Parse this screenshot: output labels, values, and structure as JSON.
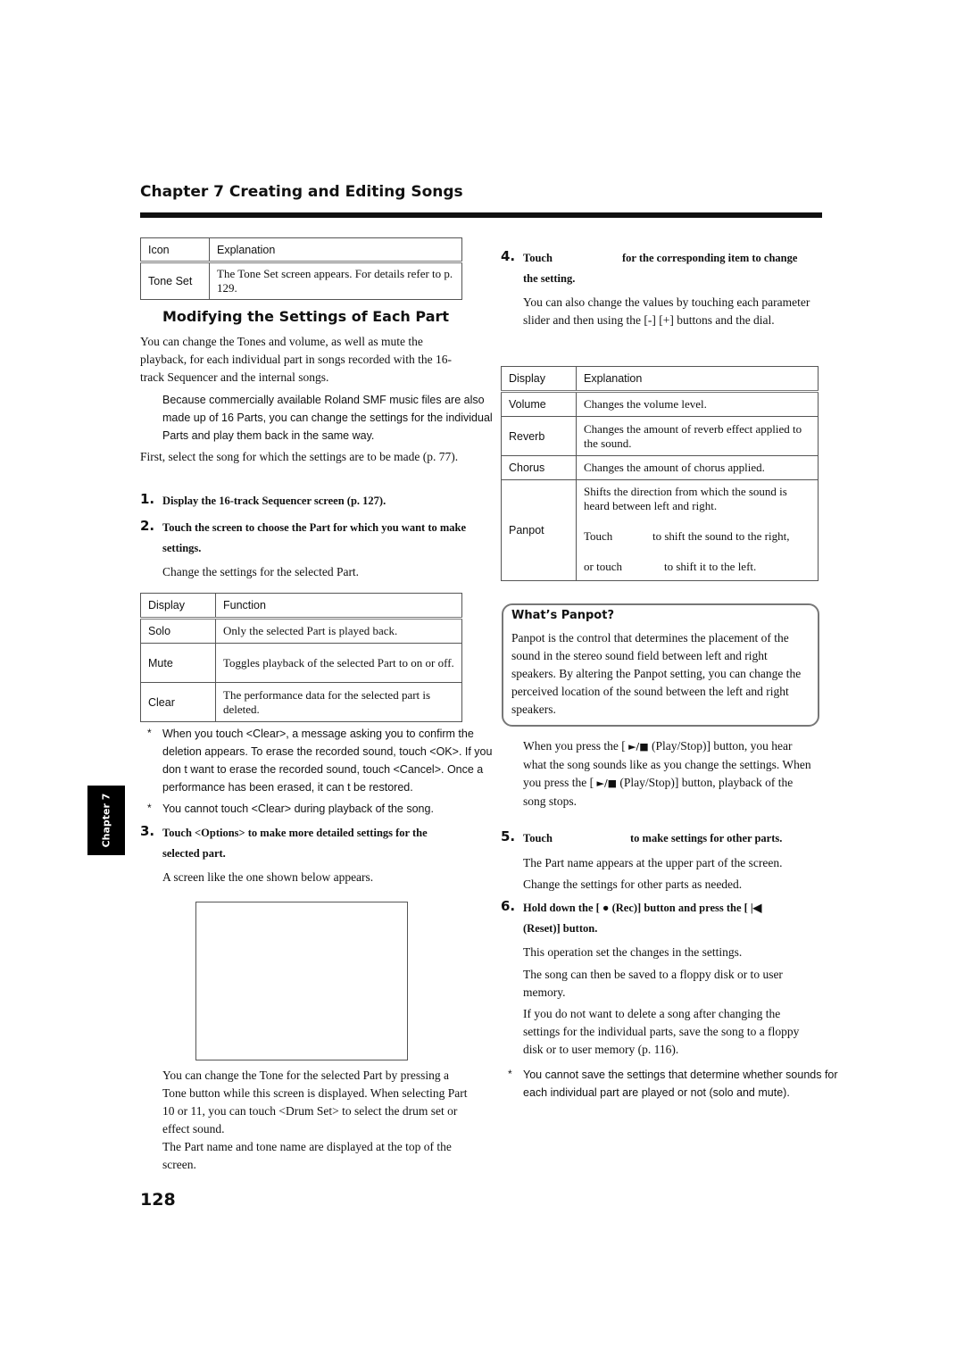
{
  "header": {
    "chapter_title": "Chapter 7 Creating and Editing Songs"
  },
  "icon_table": {
    "headers": [
      "Icon",
      "Explanation"
    ],
    "rows": [
      {
        "key": "Tone Set",
        "value": "The Tone Set screen appears. For details refer to p. 129."
      }
    ]
  },
  "section": {
    "title": "Modifying the Settings of Each Part",
    "intro": "You can change the Tones and volume, as well as mute the playback, for each individual part in songs recorded with the 16-track Sequencer and the internal songs.",
    "note": "Because commercially available Roland SMF music files are also made up of 16 Parts, you can change the settings for the individual Parts and play them back in the same way.",
    "first": "First, select the song for which the settings are to be made (p. 77)."
  },
  "steps": {
    "s1": {
      "num": "1.",
      "text": "Display the 16-track Sequencer screen (p. 127)."
    },
    "s2": {
      "num": "2.",
      "text": "Touch the screen to choose the Part for which you want to make settings.",
      "body": "Change the settings for the selected Part."
    },
    "s3": {
      "num": "3.",
      "text": "Touch <Options> to make more detailed settings for the selected part.",
      "body": "A screen like the one shown below appears."
    },
    "s4": {
      "num": "4.",
      "text_a": "Touch",
      "text_b": "for the corresponding item to change",
      "text_c": "the setting.",
      "body": "You can also change the values by touching each parameter slider and then using the [-] [+] buttons and the dial."
    },
    "s5": {
      "num": "5.",
      "text_a": "Touch",
      "text_b": "to make settings for other parts.",
      "body1": "The Part name appears at the upper part of the screen.",
      "body2": "Change the settings for other parts as needed."
    },
    "s6": {
      "num": "6.",
      "text_a": "Hold down the [",
      "rec_glyph": "●",
      "text_b": "(Rec)] button and press the [",
      "reset_glyph": "|◀",
      "text_c": "(Reset)] button.",
      "body1": "This operation set the changes in the settings.",
      "body2": "The song can then be saved to a floppy disk or to user memory.",
      "body3": "If you do not want to delete a song after changing the settings for the individual parts, save the song to a floppy disk or to user memory (p. 116)."
    }
  },
  "function_table": {
    "headers": [
      "Display",
      "Function"
    ],
    "rows": [
      {
        "key": "Solo",
        "value": "Only the selected Part is played back."
      },
      {
        "key": "Mute",
        "value": "Toggles playback of the selected Part to on or off."
      },
      {
        "key": "Clear",
        "value": "The performance data for the selected part is deleted."
      }
    ]
  },
  "notes_left": [
    "When you touch <Clear>, a message asking you to confirm the deletion appears. To erase the recorded sound, touch <OK>. If you don t want to erase the recorded sound, touch <Cancel>. Once a performance has been erased, it can t be restored.",
    "You cannot touch <Clear> during playback of the song."
  ],
  "after_screen": {
    "p1": "You can change the Tone for the selected Part by pressing a Tone button while this screen is displayed. When selecting Part 10 or 11, you can touch <Drum Set> to select the drum set or effect sound.",
    "p2": "The Part name and tone name are displayed at the top of the screen."
  },
  "param_table": {
    "headers": [
      "Display",
      "Explanation"
    ],
    "rows": [
      {
        "key": "Volume",
        "value": "Changes the volume level."
      },
      {
        "key": "Reverb",
        "value": "Changes the amount of reverb effect applied to the sound."
      },
      {
        "key": "Chorus",
        "value": "Changes the amount of chorus applied."
      }
    ],
    "panpot": {
      "key": "Panpot",
      "line1": "Shifts the direction from which the sound is heard between left and right.",
      "touch_a": "Touch",
      "touch_b": "to shift the sound to the right,",
      "or_a": "or touch",
      "or_b": "to shift it to the left."
    }
  },
  "callout": {
    "title": "What’s Panpot?",
    "body": "Panpot is the control that determines the placement of the sound in the stereo sound field between left and right speakers. By altering the Panpot setting, you can change the perceived location of the sound between the left and right speakers."
  },
  "playstop": {
    "a": "When you press the [",
    "glyph": "►/■",
    "b": "(Play/Stop)] button, you hear what the song sounds like as you change the settings. When you press the [",
    "c": "(Play/Stop)] button, playback of the song stops."
  },
  "notes_right": [
    "You cannot save the settings that determine whether sounds for each individual part are played or not (solo and mute)."
  ],
  "star": "*",
  "side_tab": "Chapter 7",
  "page_number": "128"
}
